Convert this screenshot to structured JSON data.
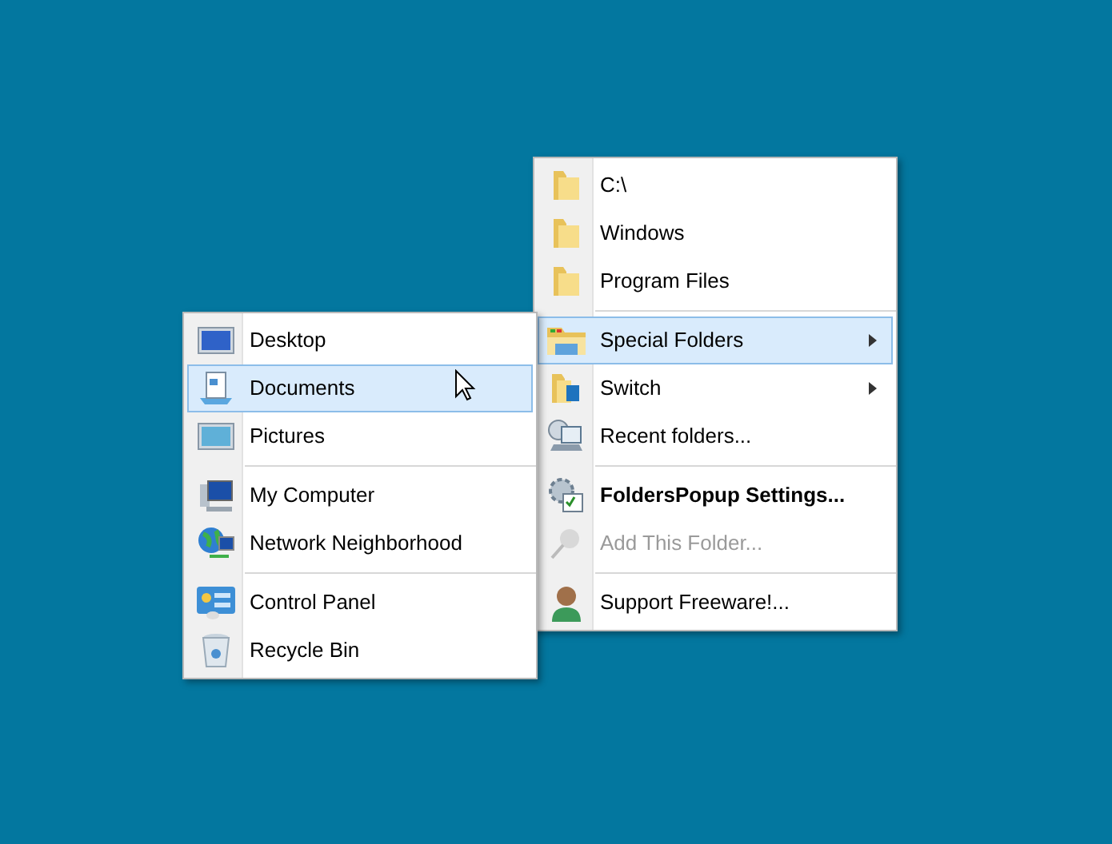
{
  "main_menu": {
    "groups": [
      {
        "items": [
          {
            "label": "C:\\",
            "selected": false,
            "disabled": false,
            "bold": false,
            "has_submenu": false
          },
          {
            "label": "Windows",
            "selected": false,
            "disabled": false,
            "bold": false,
            "has_submenu": false
          },
          {
            "label": "Program Files",
            "selected": false,
            "disabled": false,
            "bold": false,
            "has_submenu": false
          }
        ]
      },
      {
        "items": [
          {
            "label": "Special Folders",
            "selected": true,
            "disabled": false,
            "bold": false,
            "has_submenu": true
          },
          {
            "label": "Switch",
            "selected": false,
            "disabled": false,
            "bold": false,
            "has_submenu": true
          },
          {
            "label": "Recent folders...",
            "selected": false,
            "disabled": false,
            "bold": false,
            "has_submenu": false
          }
        ]
      },
      {
        "items": [
          {
            "label": "FoldersPopup Settings...",
            "selected": false,
            "disabled": false,
            "bold": true,
            "has_submenu": false
          },
          {
            "label": "Add This Folder...",
            "selected": false,
            "disabled": true,
            "bold": false,
            "has_submenu": false
          }
        ]
      },
      {
        "items": [
          {
            "label": "Support Freeware!...",
            "selected": false,
            "disabled": false,
            "bold": false,
            "has_submenu": false
          }
        ]
      }
    ]
  },
  "submenu": {
    "groups": [
      {
        "items": [
          {
            "label": "Desktop",
            "selected": false,
            "disabled": false,
            "bold": false,
            "has_submenu": false
          },
          {
            "label": "Documents",
            "selected": true,
            "disabled": false,
            "bold": false,
            "has_submenu": false
          },
          {
            "label": "Pictures",
            "selected": false,
            "disabled": false,
            "bold": false,
            "has_submenu": false
          }
        ]
      },
      {
        "items": [
          {
            "label": "My Computer",
            "selected": false,
            "disabled": false,
            "bold": false,
            "has_submenu": false
          },
          {
            "label": "Network Neighborhood",
            "selected": false,
            "disabled": false,
            "bold": false,
            "has_submenu": false
          }
        ]
      },
      {
        "items": [
          {
            "label": "Control Panel",
            "selected": false,
            "disabled": false,
            "bold": false,
            "has_submenu": false
          },
          {
            "label": "Recycle Bin",
            "selected": false,
            "disabled": false,
            "bold": false,
            "has_submenu": false
          }
        ]
      }
    ]
  }
}
